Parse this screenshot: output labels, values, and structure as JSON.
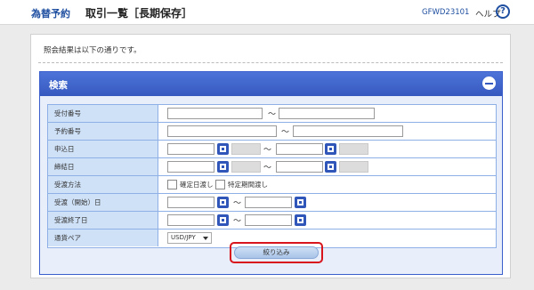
{
  "header": {
    "app_title": "為替予約",
    "page_title": "取引一覧［長期保存］",
    "screen_id": "GFWD23101",
    "help_label": "ヘルプ",
    "help_icon": "?"
  },
  "info_text": "照会結果は以下の通りです。",
  "search_panel": {
    "title": "検索",
    "fields": {
      "receipt_no": "受付番号",
      "reservation_no": "予約番号",
      "application_date": "申込日",
      "conclusion_date": "締結日",
      "delivery_method": "受渡方法",
      "delivery_start_date": "受渡（開始）日",
      "delivery_end_date": "受渡終了日",
      "currency_pair": "通貨ペア"
    },
    "range_separator": "～",
    "delivery_options": {
      "fixed": "確定日渡し",
      "period": "特定期間渡し"
    },
    "currency_pair_value": "USD/JPY",
    "search_button": "絞り込み"
  },
  "icons": {
    "help": "help-circle-icon",
    "collapse": "minus-circle-icon",
    "calendar": "calendar-icon",
    "dropdown": "chevron-down-icon"
  },
  "colors": {
    "brand_blue": "#1f4fa0",
    "panel_header": "#3659c0",
    "label_bg": "#cfe1f7",
    "highlight_red": "#d8141c"
  }
}
